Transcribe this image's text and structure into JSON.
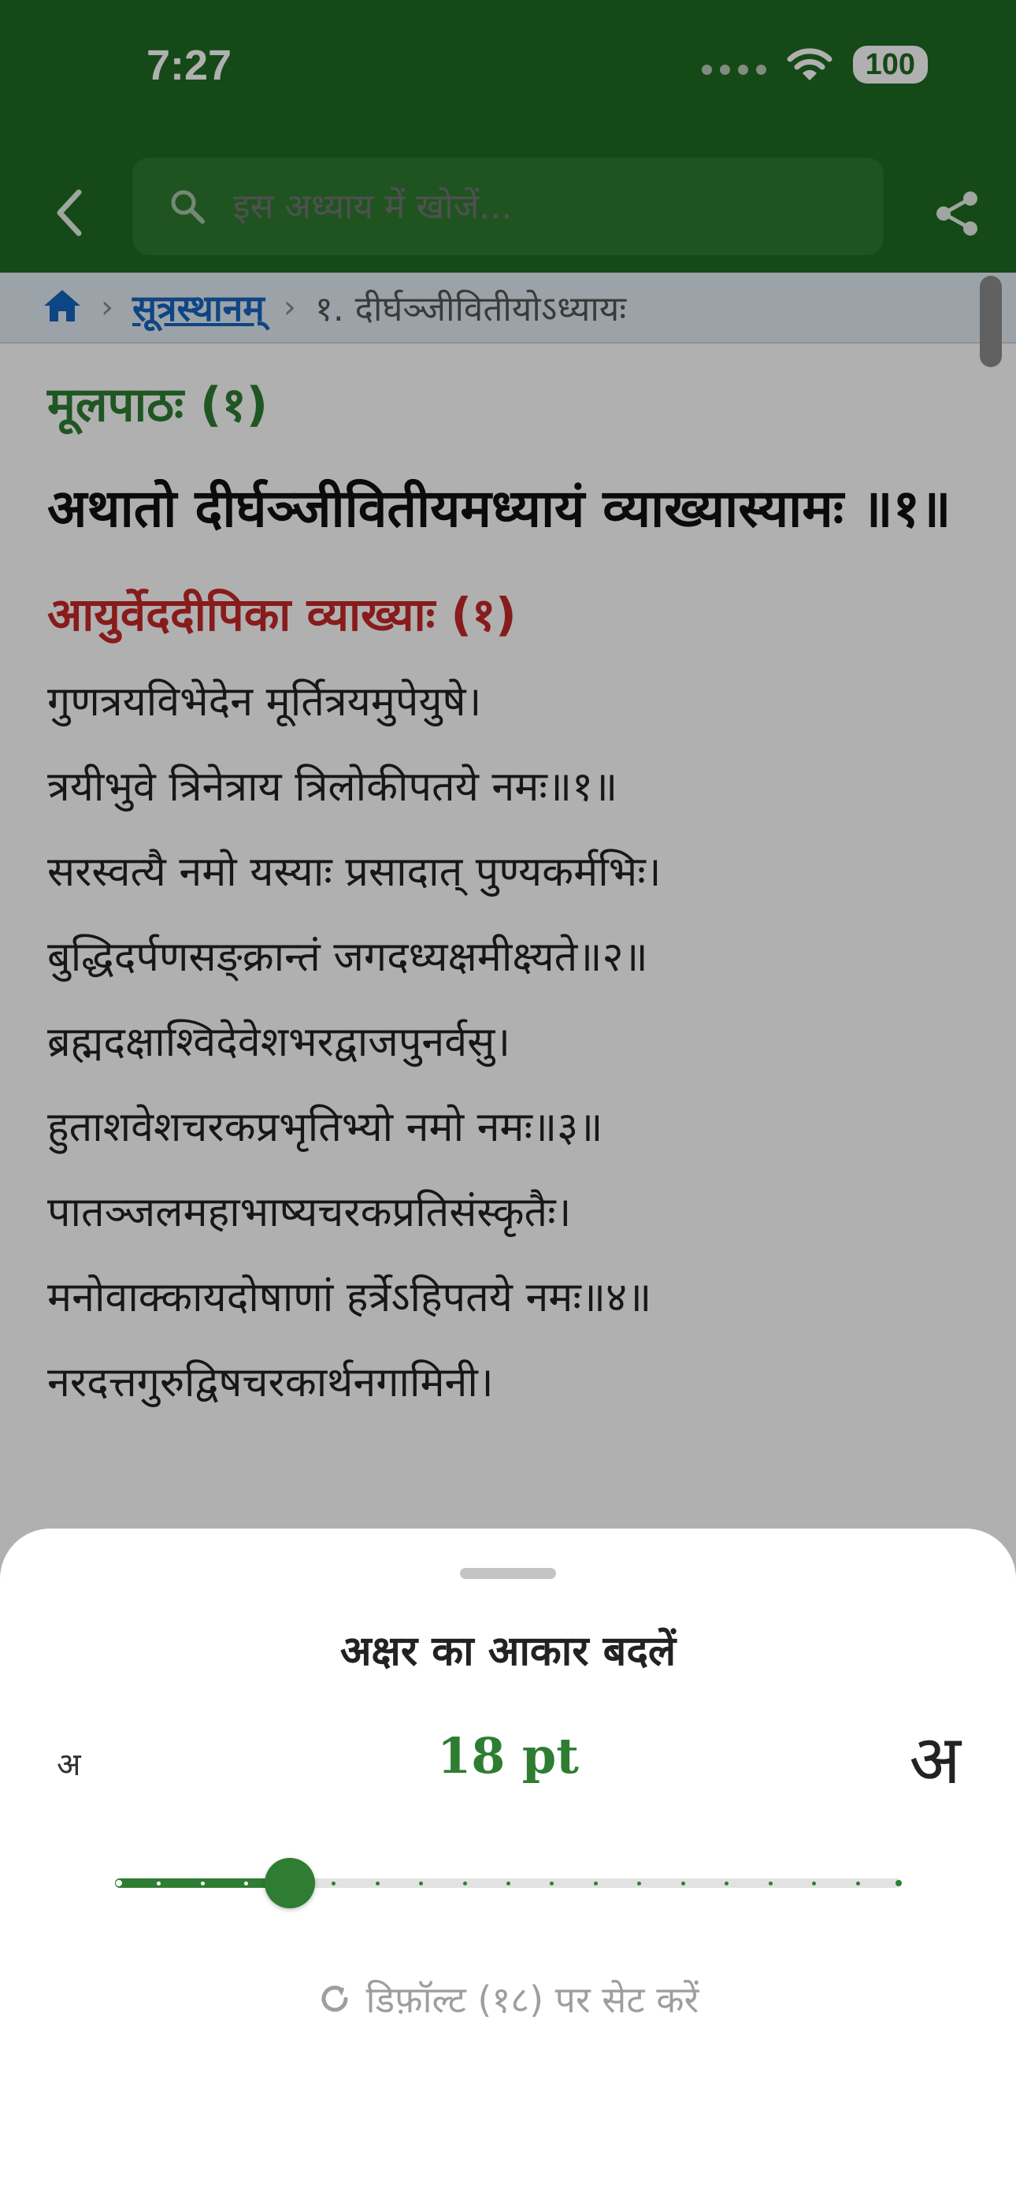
{
  "status": {
    "time": "7:27",
    "battery": "100"
  },
  "appbar": {
    "search_placeholder": "इस अध्याय में खोजें..."
  },
  "breadcrumb": {
    "section": "सूत्रस्थानम्",
    "chapter": "१. दीर्घञ्जीवितीयोऽध्यायः"
  },
  "content": {
    "mula_heading": "मूलपाठः (१)",
    "mula_text": "अथातो दीर्घञ्जीवितीयमध्यायं व्याख्यास्यामः ॥१॥",
    "vyakhya_heading": "आयुर्वेददीपिका व्याख्याः (१)",
    "lines": [
      "गुणत्रयविभेदेन मूर्तित्रयमुपेयुषे।",
      "त्रयीभुवे त्रिनेत्राय त्रिलोकीपतये नमः॥१॥",
      "सरस्वत्यै नमो यस्याः प्रसादात् पुण्यकर्मभिः।",
      "बुद्धिदर्पणसङ्क्रान्तं जगदध्यक्षमीक्ष्यते॥२॥",
      "ब्रह्मदक्षाश्विदेवेशभरद्वाजपुनर्वसु।",
      "हुताशवेशचरकप्रभृतिभ्यो नमो नमः॥३॥",
      "पातञ्जलमहाभाष्यचरकप्रतिसंस्कृतैः।",
      "मनोवाक्कायदोषाणां हर्त्रेऽहिपतये नमः॥४॥",
      "नरदत्तगुरुद्विषचरकार्थनगामिनी।"
    ]
  },
  "sheet": {
    "title": "अक्षर का आकार बदलें",
    "small_label": "अ",
    "large_label": "अ",
    "size_value": "18 pt",
    "slider": {
      "steps": 19,
      "selected_index": 4
    },
    "reset_label": "डिफ़ॉल्ट (१८) पर सेट करें"
  },
  "colors": {
    "primary": "#1f6b22",
    "accent": "#2e7d32",
    "link": "#1565c0",
    "commentary_heading": "#c62828"
  },
  "icons": [
    "back-icon",
    "search-icon",
    "share-icon",
    "home-icon",
    "wifi-icon",
    "reset-icon"
  ]
}
